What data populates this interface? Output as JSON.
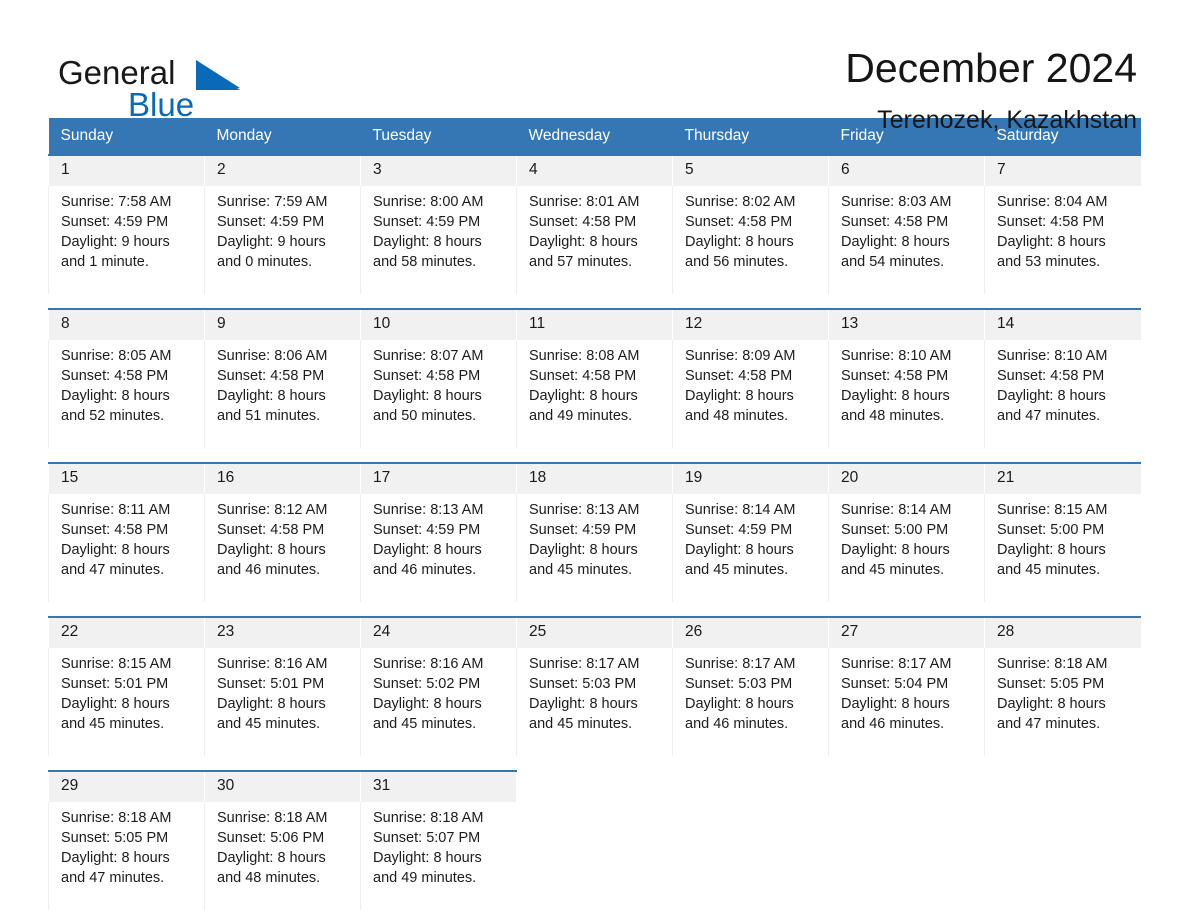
{
  "brand": {
    "word_one": "General",
    "word_two": "Blue",
    "flag_icon": "triangle-flag-icon",
    "accent_color": "#0b6ab8"
  },
  "header": {
    "title": "December 2024",
    "subtitle": "Terenozek, Kazakhstan",
    "header_bg": "#3576b5",
    "daynum_bg": "#f1f1f1"
  },
  "weekdays": [
    "Sunday",
    "Monday",
    "Tuesday",
    "Wednesday",
    "Thursday",
    "Friday",
    "Saturday"
  ],
  "weeks": [
    {
      "days": [
        {
          "date": "1",
          "sunrise": "Sunrise: 7:58 AM",
          "sunset": "Sunset: 4:59 PM",
          "daylight_1": "Daylight: 9 hours",
          "daylight_2": "and 1 minute."
        },
        {
          "date": "2",
          "sunrise": "Sunrise: 7:59 AM",
          "sunset": "Sunset: 4:59 PM",
          "daylight_1": "Daylight: 9 hours",
          "daylight_2": "and 0 minutes."
        },
        {
          "date": "3",
          "sunrise": "Sunrise: 8:00 AM",
          "sunset": "Sunset: 4:59 PM",
          "daylight_1": "Daylight: 8 hours",
          "daylight_2": "and 58 minutes."
        },
        {
          "date": "4",
          "sunrise": "Sunrise: 8:01 AM",
          "sunset": "Sunset: 4:58 PM",
          "daylight_1": "Daylight: 8 hours",
          "daylight_2": "and 57 minutes."
        },
        {
          "date": "5",
          "sunrise": "Sunrise: 8:02 AM",
          "sunset": "Sunset: 4:58 PM",
          "daylight_1": "Daylight: 8 hours",
          "daylight_2": "and 56 minutes."
        },
        {
          "date": "6",
          "sunrise": "Sunrise: 8:03 AM",
          "sunset": "Sunset: 4:58 PM",
          "daylight_1": "Daylight: 8 hours",
          "daylight_2": "and 54 minutes."
        },
        {
          "date": "7",
          "sunrise": "Sunrise: 8:04 AM",
          "sunset": "Sunset: 4:58 PM",
          "daylight_1": "Daylight: 8 hours",
          "daylight_2": "and 53 minutes."
        }
      ]
    },
    {
      "days": [
        {
          "date": "8",
          "sunrise": "Sunrise: 8:05 AM",
          "sunset": "Sunset: 4:58 PM",
          "daylight_1": "Daylight: 8 hours",
          "daylight_2": "and 52 minutes."
        },
        {
          "date": "9",
          "sunrise": "Sunrise: 8:06 AM",
          "sunset": "Sunset: 4:58 PM",
          "daylight_1": "Daylight: 8 hours",
          "daylight_2": "and 51 minutes."
        },
        {
          "date": "10",
          "sunrise": "Sunrise: 8:07 AM",
          "sunset": "Sunset: 4:58 PM",
          "daylight_1": "Daylight: 8 hours",
          "daylight_2": "and 50 minutes."
        },
        {
          "date": "11",
          "sunrise": "Sunrise: 8:08 AM",
          "sunset": "Sunset: 4:58 PM",
          "daylight_1": "Daylight: 8 hours",
          "daylight_2": "and 49 minutes."
        },
        {
          "date": "12",
          "sunrise": "Sunrise: 8:09 AM",
          "sunset": "Sunset: 4:58 PM",
          "daylight_1": "Daylight: 8 hours",
          "daylight_2": "and 48 minutes."
        },
        {
          "date": "13",
          "sunrise": "Sunrise: 8:10 AM",
          "sunset": "Sunset: 4:58 PM",
          "daylight_1": "Daylight: 8 hours",
          "daylight_2": "and 48 minutes."
        },
        {
          "date": "14",
          "sunrise": "Sunrise: 8:10 AM",
          "sunset": "Sunset: 4:58 PM",
          "daylight_1": "Daylight: 8 hours",
          "daylight_2": "and 47 minutes."
        }
      ]
    },
    {
      "days": [
        {
          "date": "15",
          "sunrise": "Sunrise: 8:11 AM",
          "sunset": "Sunset: 4:58 PM",
          "daylight_1": "Daylight: 8 hours",
          "daylight_2": "and 47 minutes."
        },
        {
          "date": "16",
          "sunrise": "Sunrise: 8:12 AM",
          "sunset": "Sunset: 4:58 PM",
          "daylight_1": "Daylight: 8 hours",
          "daylight_2": "and 46 minutes."
        },
        {
          "date": "17",
          "sunrise": "Sunrise: 8:13 AM",
          "sunset": "Sunset: 4:59 PM",
          "daylight_1": "Daylight: 8 hours",
          "daylight_2": "and 46 minutes."
        },
        {
          "date": "18",
          "sunrise": "Sunrise: 8:13 AM",
          "sunset": "Sunset: 4:59 PM",
          "daylight_1": "Daylight: 8 hours",
          "daylight_2": "and 45 minutes."
        },
        {
          "date": "19",
          "sunrise": "Sunrise: 8:14 AM",
          "sunset": "Sunset: 4:59 PM",
          "daylight_1": "Daylight: 8 hours",
          "daylight_2": "and 45 minutes."
        },
        {
          "date": "20",
          "sunrise": "Sunrise: 8:14 AM",
          "sunset": "Sunset: 5:00 PM",
          "daylight_1": "Daylight: 8 hours",
          "daylight_2": "and 45 minutes."
        },
        {
          "date": "21",
          "sunrise": "Sunrise: 8:15 AM",
          "sunset": "Sunset: 5:00 PM",
          "daylight_1": "Daylight: 8 hours",
          "daylight_2": "and 45 minutes."
        }
      ]
    },
    {
      "days": [
        {
          "date": "22",
          "sunrise": "Sunrise: 8:15 AM",
          "sunset": "Sunset: 5:01 PM",
          "daylight_1": "Daylight: 8 hours",
          "daylight_2": "and 45 minutes."
        },
        {
          "date": "23",
          "sunrise": "Sunrise: 8:16 AM",
          "sunset": "Sunset: 5:01 PM",
          "daylight_1": "Daylight: 8 hours",
          "daylight_2": "and 45 minutes."
        },
        {
          "date": "24",
          "sunrise": "Sunrise: 8:16 AM",
          "sunset": "Sunset: 5:02 PM",
          "daylight_1": "Daylight: 8 hours",
          "daylight_2": "and 45 minutes."
        },
        {
          "date": "25",
          "sunrise": "Sunrise: 8:17 AM",
          "sunset": "Sunset: 5:03 PM",
          "daylight_1": "Daylight: 8 hours",
          "daylight_2": "and 45 minutes."
        },
        {
          "date": "26",
          "sunrise": "Sunrise: 8:17 AM",
          "sunset": "Sunset: 5:03 PM",
          "daylight_1": "Daylight: 8 hours",
          "daylight_2": "and 46 minutes."
        },
        {
          "date": "27",
          "sunrise": "Sunrise: 8:17 AM",
          "sunset": "Sunset: 5:04 PM",
          "daylight_1": "Daylight: 8 hours",
          "daylight_2": "and 46 minutes."
        },
        {
          "date": "28",
          "sunrise": "Sunrise: 8:18 AM",
          "sunset": "Sunset: 5:05 PM",
          "daylight_1": "Daylight: 8 hours",
          "daylight_2": "and 47 minutes."
        }
      ]
    },
    {
      "days": [
        {
          "date": "29",
          "sunrise": "Sunrise: 8:18 AM",
          "sunset": "Sunset: 5:05 PM",
          "daylight_1": "Daylight: 8 hours",
          "daylight_2": "and 47 minutes."
        },
        {
          "date": "30",
          "sunrise": "Sunrise: 8:18 AM",
          "sunset": "Sunset: 5:06 PM",
          "daylight_1": "Daylight: 8 hours",
          "daylight_2": "and 48 minutes."
        },
        {
          "date": "31",
          "sunrise": "Sunrise: 8:18 AM",
          "sunset": "Sunset: 5:07 PM",
          "daylight_1": "Daylight: 8 hours",
          "daylight_2": "and 49 minutes."
        },
        {
          "date": "",
          "sunrise": "",
          "sunset": "",
          "daylight_1": "",
          "daylight_2": ""
        },
        {
          "date": "",
          "sunrise": "",
          "sunset": "",
          "daylight_1": "",
          "daylight_2": ""
        },
        {
          "date": "",
          "sunrise": "",
          "sunset": "",
          "daylight_1": "",
          "daylight_2": ""
        },
        {
          "date": "",
          "sunrise": "",
          "sunset": "",
          "daylight_1": "",
          "daylight_2": ""
        }
      ]
    }
  ]
}
